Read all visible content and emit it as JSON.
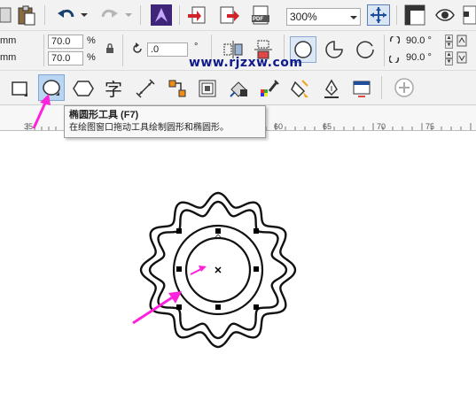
{
  "toolbar": {
    "zoom_value": "300%",
    "pdf_label": "PDF"
  },
  "property_bar": {
    "width_unit": "mm",
    "height_unit": "mm",
    "scale_x": "70.0",
    "scale_y": "70.0",
    "percent_symbol": "%",
    "rotation": ".0",
    "degree_symbol": "°",
    "start_angle": "90.0 °",
    "end_angle": "90.0 °"
  },
  "toolbox": {
    "text_tool_glyph": "字",
    "plus_glyph": "+"
  },
  "watermark": "www.rjzxw.com",
  "ruler": {
    "ticks": [
      "35",
      "60",
      "65",
      "70",
      "75"
    ]
  },
  "tooltip": {
    "title": "椭圆形工具 (F7)",
    "description": "在绘图窗口拖动工具绘制圆形和椭圆形。"
  },
  "colors": {
    "annotation_arrow": "#ff22dd",
    "watermark": "#0f1a8c",
    "tool_highlight": "#b9d5f2"
  }
}
